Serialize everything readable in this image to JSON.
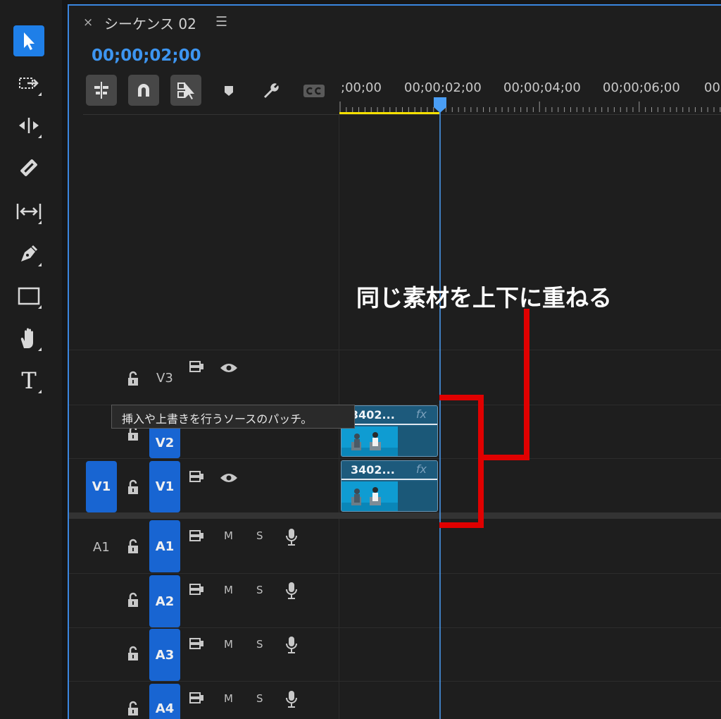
{
  "tools": [
    {
      "name": "selection-tool",
      "icon": "arrow-icon",
      "active": true
    },
    {
      "name": "track-select-tool",
      "icon": "track-select-icon"
    },
    {
      "name": "ripple-edit-tool",
      "icon": "ripple-edit-icon"
    },
    {
      "name": "razor-tool",
      "icon": "razor-icon"
    },
    {
      "name": "slip-tool",
      "icon": "slip-icon"
    },
    {
      "name": "pen-tool",
      "icon": "pen-icon"
    },
    {
      "name": "rectangle-tool",
      "icon": "rectangle-icon"
    },
    {
      "name": "hand-tool",
      "icon": "hand-icon"
    },
    {
      "name": "type-tool",
      "icon": "type-icon",
      "glyph": "T"
    }
  ],
  "sequence": {
    "close_glyph": "×",
    "title": "シーケンス 02",
    "menu_glyph": "☰",
    "timecode": "00;00;02;00"
  },
  "toolbar_icons": [
    "insert-overwrite-icon",
    "snap-icon",
    "linked-selection-icon",
    "marker-icon",
    "settings-wrench-icon",
    "captions-icon"
  ],
  "ruler": {
    "labels": [
      ";00;00",
      "00;00;02;00",
      "00;00;04;00",
      "00;00;06;00",
      "00"
    ]
  },
  "tracks": {
    "v3": {
      "label": "V3"
    },
    "v2": {
      "label": "V2"
    },
    "v1": {
      "source": "V1",
      "label": "V1"
    },
    "a1": {
      "source": "A1",
      "label": "A1",
      "m": "M",
      "s": "S"
    },
    "a2": {
      "label": "A2",
      "m": "M",
      "s": "S"
    },
    "a3": {
      "label": "A3",
      "m": "M",
      "s": "S"
    },
    "a4": {
      "label": "A4",
      "m": "M",
      "s": "S"
    }
  },
  "clips": [
    {
      "track": "V2",
      "name": "3402...",
      "fx": "fx"
    },
    {
      "track": "V1",
      "name": "3402...",
      "fx": "fx"
    }
  ],
  "tooltip": "挿入や上書きを行うソースのパッチ。",
  "annotation": "同じ素材を上下に重ねる",
  "colors": {
    "accent": "#3d95f0",
    "track_button": "#1865d2",
    "playhead": "#4a9ef5",
    "annotation_bracket": "#e00000",
    "work_area": "#f5e000"
  }
}
